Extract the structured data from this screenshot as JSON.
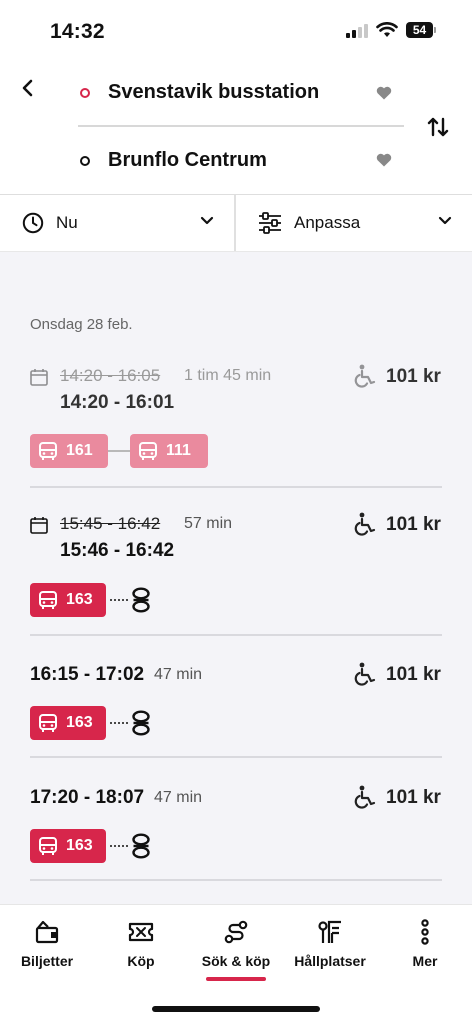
{
  "status_bar": {
    "time": "14:32",
    "battery": "54"
  },
  "route": {
    "from": "Svenstavik busstation",
    "to": "Brunflo Centrum"
  },
  "filters": {
    "time_label": "Nu",
    "adjust_label": "Anpassa"
  },
  "date_header": "Onsdag 28 feb.",
  "trips": [
    {
      "old_time": "14:20 - 16:05",
      "duration": "1 tim 45 min",
      "new_time": "14:20 - 16:01",
      "price": "101 kr",
      "legs": [
        "161",
        "111"
      ],
      "state": "departed"
    },
    {
      "old_time": "15:45 - 16:42",
      "duration": "57 min",
      "new_time": "15:46 - 16:42",
      "price": "101 kr",
      "legs": [
        "163"
      ],
      "state": "changed"
    },
    {
      "time": "16:15 - 17:02",
      "duration": "47 min",
      "price": "101 kr",
      "legs": [
        "163"
      ]
    },
    {
      "time": "17:20 - 18:07",
      "duration": "47 min",
      "price": "101 kr",
      "legs": [
        "163"
      ]
    }
  ],
  "tabs": [
    {
      "label": "Biljetter",
      "icon": "ticket-wallet-icon"
    },
    {
      "label": "Köp",
      "icon": "ticket-icon"
    },
    {
      "label": "Sök & köp",
      "icon": "route-search-icon",
      "active": true
    },
    {
      "label": "Hållplatser",
      "icon": "bus-stop-icon"
    },
    {
      "label": "Mer",
      "icon": "more-vertical-icon"
    }
  ],
  "colors": {
    "accent": "#d7264b",
    "accent_faded": "#ea8a9e"
  }
}
